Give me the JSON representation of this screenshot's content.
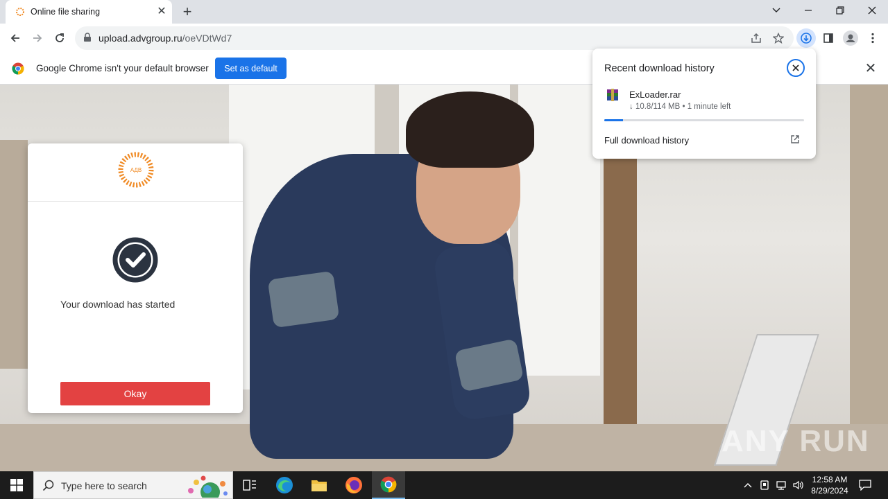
{
  "browser": {
    "tab_title": "Online file sharing",
    "url_host": "upload.advgroup.ru",
    "url_path": "/oeVDtWd7"
  },
  "infobar": {
    "message": "Google Chrome isn't your default browser",
    "button_label": "Set as default"
  },
  "modal": {
    "logo_text": "АДВ",
    "message": "Your download has started",
    "button_label": "Okay"
  },
  "download_popup": {
    "title": "Recent download history",
    "filename": "ExLoader.rar",
    "status": "↓ 10.8/114 MB • 1 minute left",
    "progress_fraction": 0.095,
    "full_history_label": "Full download history"
  },
  "watermark": "ANY RUN",
  "taskbar": {
    "search_placeholder": "Type here to search",
    "time": "12:58 AM",
    "date": "8/29/2024"
  },
  "colors": {
    "accent": "#1a73e8",
    "okay_button": "#e34242",
    "taskbar": "#1c1c1c"
  }
}
